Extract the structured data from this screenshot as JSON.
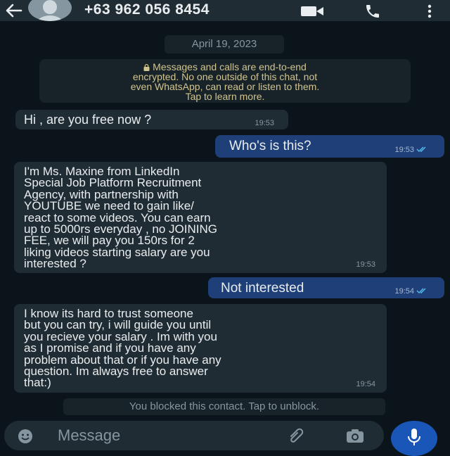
{
  "header": {
    "contact": "+63 962 056 8454",
    "icons": {
      "back": "arrow-left-icon",
      "avatar": "default-avatar",
      "video": "video-call-icon",
      "call": "phone-icon",
      "menu": "more-vert-icon"
    }
  },
  "chat": {
    "date": "April 19, 2023",
    "encryption_notice": [
      "Messages and calls are end-to-end",
      "encrypted. No one outside of this chat, not",
      "even WhatsApp, can read or listen to them.",
      "Tap to learn more."
    ],
    "messages": [
      {
        "direction": "incoming",
        "lines": [
          "Hi , are you free now  ?"
        ],
        "time": "19:53"
      },
      {
        "direction": "outgoing",
        "lines": [
          "Who's is this?"
        ],
        "time": "19:53",
        "status": "read"
      },
      {
        "direction": "incoming",
        "lines": [
          "I'm Ms. Maxine from  LinkedIn",
          "Special Job Platform Recruitment",
          "Agency, with partnership with",
          "YOUTUBE we need to gain like/",
          "react to some videos. You can earn",
          "up to 5000rs everyday , no JOINING",
          "FEE, we will pay you 150rs for 2",
          "liking videos starting salary are you",
          "interested ?"
        ],
        "time": "19:53"
      },
      {
        "direction": "outgoing",
        "lines": [
          "Not interested"
        ],
        "time": "19:54",
        "status": "read"
      },
      {
        "direction": "incoming",
        "lines": [
          "I know its hard to trust someone",
          "but you can try, i will guide you until",
          "you recieve your salary . Im with you",
          "as I promise and if you have any",
          "problem about that or if you have any",
          "question. Im always free to answer",
          "that:)"
        ],
        "time": "19:54"
      }
    ],
    "blocked_notice": "You blocked this contact. Tap to unblock."
  },
  "composer": {
    "placeholder": "Message",
    "icons": {
      "emoji": "emoji-icon",
      "attach": "attach-icon",
      "camera": "camera-icon",
      "mic": "mic-icon"
    }
  },
  "colors": {
    "background": "#0b141a",
    "header": "#1f2c34",
    "incoming_bubble": "#202c33",
    "outgoing_bubble": "#1e3f78",
    "notice_text": "#d1c48e",
    "mic_button": "#1a56b8"
  }
}
